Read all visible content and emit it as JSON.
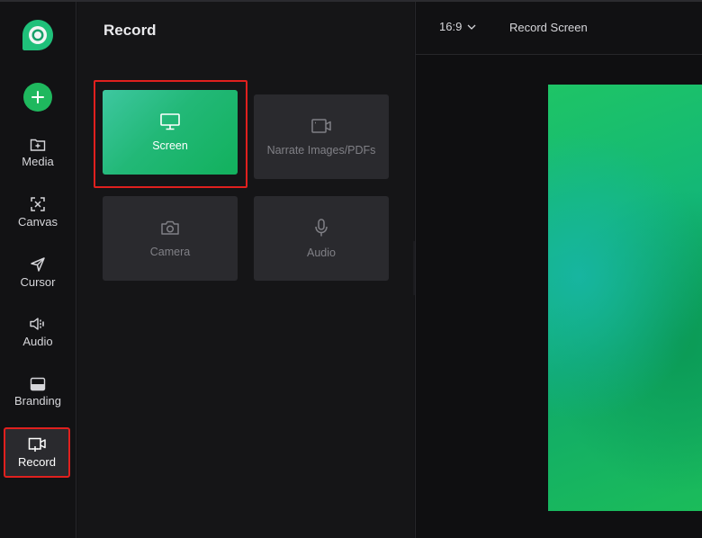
{
  "sidebar": {
    "items": [
      {
        "label": "Media",
        "icon": "folder-plus-icon"
      },
      {
        "label": "Canvas",
        "icon": "canvas-crop-icon"
      },
      {
        "label": "Cursor",
        "icon": "cursor-icon"
      },
      {
        "label": "Audio",
        "icon": "speaker-icon"
      },
      {
        "label": "Branding",
        "icon": "branding-icon"
      },
      {
        "label": "Record",
        "icon": "record-icon",
        "active": true
      }
    ],
    "add_icon": "plus-icon",
    "accent": "#1fb85e"
  },
  "panel": {
    "title": "Record",
    "options": [
      {
        "label": "Screen",
        "icon": "monitor-icon",
        "selected": true
      },
      {
        "label": "Narrate Images/PDFs",
        "icon": "video-frame-icon"
      },
      {
        "label": "Camera",
        "icon": "camera-icon"
      },
      {
        "label": "Audio",
        "icon": "microphone-icon"
      }
    ]
  },
  "preview": {
    "aspect_ratio": "16:9",
    "mode_label": "Record Screen"
  },
  "colors": {
    "highlight": "#e0201e",
    "selected_card_start": "#3ec7a0",
    "selected_card_end": "#12b15d"
  }
}
